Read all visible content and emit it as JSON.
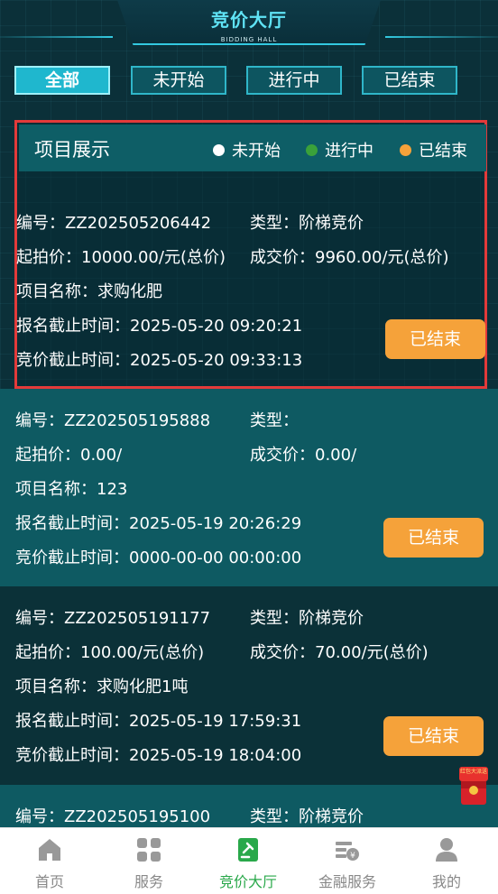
{
  "header": {
    "title": "竞价大厅",
    "subtitle": "BIDDING HALL"
  },
  "tabs": [
    {
      "label": "全部",
      "active": true
    },
    {
      "label": "未开始",
      "active": false
    },
    {
      "label": "进行中",
      "active": false
    },
    {
      "label": "已结束",
      "active": false
    }
  ],
  "legend": {
    "title": "项目展示",
    "items": [
      {
        "label": "未开始",
        "color": "#ffffff"
      },
      {
        "label": "进行中",
        "color": "#3aa13a"
      },
      {
        "label": "已结束",
        "color": "#f5a23a"
      }
    ]
  },
  "items": [
    {
      "number": "编号：ZZ202505206442",
      "type": "类型：阶梯竞价",
      "start_price": "起拍价：10000.00/元(总价)",
      "deal_price": "成交价：9960.00/元(总价)",
      "name": "项目名称：求购化肥",
      "reg_deadline": "报名截止时间：2025-05-20 09:20:21",
      "bid_deadline": "竞价截止时间：2025-05-20 09:33:13",
      "status": "已结束"
    },
    {
      "number": "编号：ZZ202505195888",
      "type": "类型：",
      "start_price": "起拍价：0.00/",
      "deal_price": "成交价：0.00/",
      "name": "项目名称：123",
      "reg_deadline": "报名截止时间：2025-05-19 20:26:29",
      "bid_deadline": "竞价截止时间：0000-00-00 00:00:00",
      "status": "已结束"
    },
    {
      "number": "编号：ZZ202505191177",
      "type": "类型：阶梯竞价",
      "start_price": "起拍价：100.00/元(总价)",
      "deal_price": "成交价：70.00/元(总价)",
      "name": "项目名称：求购化肥1吨",
      "reg_deadline": "报名截止时间：2025-05-19 17:59:31",
      "bid_deadline": "竞价截止时间：2025-05-19 18:04:00",
      "status": "已结束"
    },
    {
      "number": "编号：ZZ202505195100",
      "type": "类型：阶梯竞价"
    }
  ],
  "floating_badge": {
    "text": "红包大派送"
  },
  "bottom_nav": [
    {
      "label": "首页",
      "icon": "home-icon",
      "active": false
    },
    {
      "label": "服务",
      "icon": "grid-icon",
      "active": false
    },
    {
      "label": "竞价大厅",
      "icon": "gavel-icon",
      "active": true
    },
    {
      "label": "金融服务",
      "icon": "finance-icon",
      "active": false
    },
    {
      "label": "我的",
      "icon": "user-icon",
      "active": false
    }
  ]
}
